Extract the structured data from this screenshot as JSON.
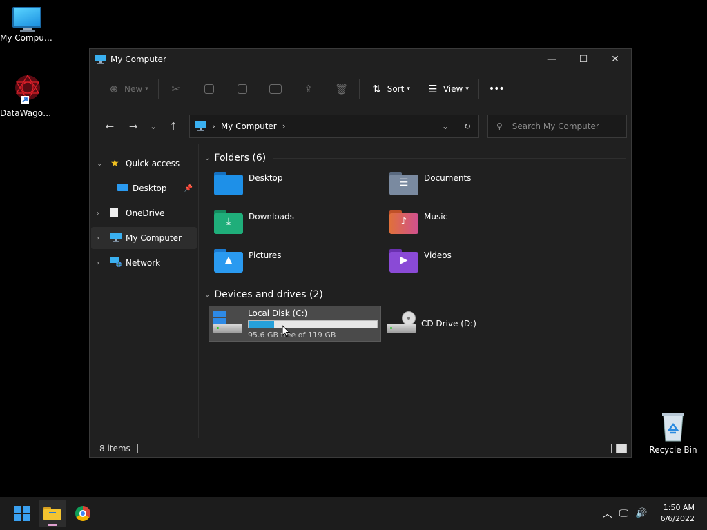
{
  "desktop": {
    "icons": [
      {
        "label": "My Computer"
      },
      {
        "label": "DataWagon..."
      },
      {
        "label": "Recycle Bin"
      }
    ]
  },
  "window": {
    "title": "My Computer",
    "controls": {
      "minimize": "—",
      "maximize": "☐",
      "close": "✕"
    }
  },
  "commandbar": {
    "new_label": "New",
    "sort_label": "Sort",
    "view_label": "View",
    "more_label": "•••"
  },
  "address": {
    "location": "My Computer",
    "search_placeholder": "Search My Computer"
  },
  "sidebar": {
    "items": [
      {
        "label": "Quick access"
      },
      {
        "label": "Desktop"
      },
      {
        "label": "OneDrive"
      },
      {
        "label": "My Computer"
      },
      {
        "label": "Network"
      }
    ]
  },
  "content": {
    "folders_header": "Folders (6)",
    "folders": [
      {
        "name": "Desktop",
        "color": "#1e90e8"
      },
      {
        "name": "Documents",
        "color": "#7a8aa0"
      },
      {
        "name": "Downloads",
        "color": "#1fae7a"
      },
      {
        "name": "Music",
        "color": "#e0703a"
      },
      {
        "name": "Pictures",
        "color": "#2a9af0"
      },
      {
        "name": "Videos",
        "color": "#8a4ad6"
      }
    ],
    "drives_header": "Devices and drives (2)",
    "drives": [
      {
        "name": "Local Disk (C:)",
        "detail": "95.6 GB free of 119 GB",
        "used_fraction": 0.197
      },
      {
        "name": "CD Drive (D:)"
      }
    ]
  },
  "status": {
    "items_count": "8 items"
  },
  "taskbar": {
    "time": "1:50 AM",
    "date": "6/6/2022"
  }
}
